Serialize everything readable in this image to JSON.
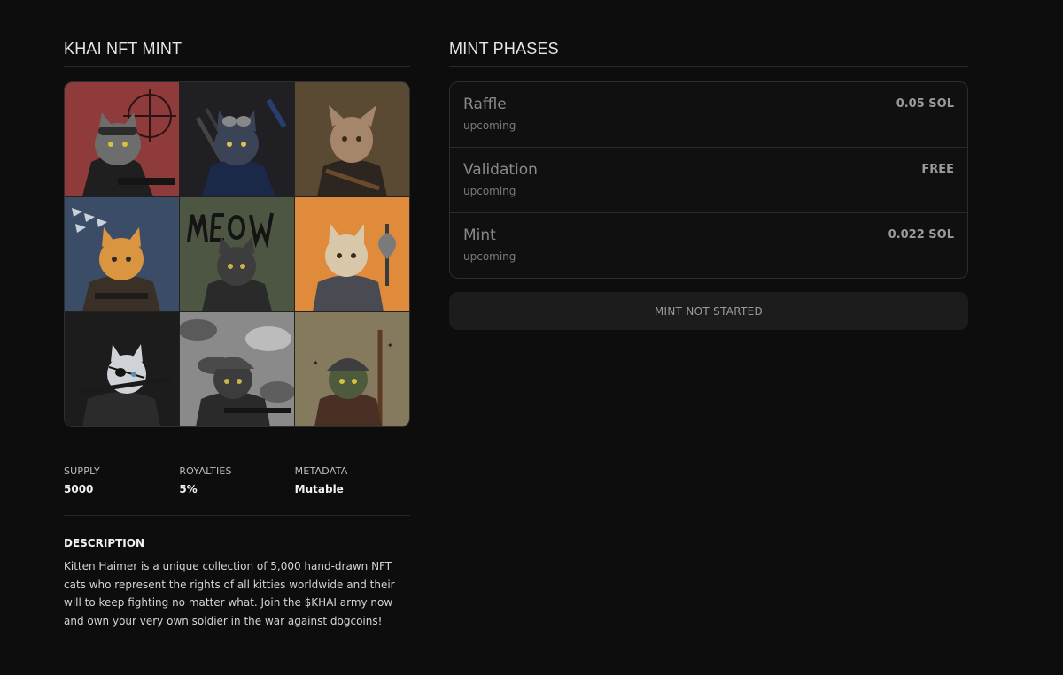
{
  "left": {
    "title": "KHAI NFT MINT",
    "gallery": [
      {
        "name": "cat-sniper",
        "bg": "#8f3b3b"
      },
      {
        "name": "cat-goggles-soldier",
        "bg": "#1f1f24"
      },
      {
        "name": "cat-warrior-bandolier",
        "bg": "#5a4a33"
      },
      {
        "name": "cat-pilot",
        "bg": "#3b4d66"
      },
      {
        "name": "cat-meow-soldier",
        "bg": "#4c5642"
      },
      {
        "name": "cat-axe-knight",
        "bg": "#e08a3c"
      },
      {
        "name": "cat-eyepatch",
        "bg": "#1c1c1c"
      },
      {
        "name": "cat-camo-soldier",
        "bg": "#8a8a8a"
      },
      {
        "name": "cat-rifleman",
        "bg": "#857a5e"
      }
    ],
    "stats": [
      {
        "label": "SUPPLY",
        "value": "5000"
      },
      {
        "label": "ROYALTIES",
        "value": "5%"
      },
      {
        "label": "METADATA",
        "value": "Mutable"
      }
    ],
    "description": {
      "title": "DESCRIPTION",
      "body": "Kitten Haimer is a unique collection of 5,000 hand-drawn NFT cats who represent the rights of all kitties worldwide and their will to keep fighting no matter what. Join the $KHAI army now and own your very own soldier in the war against dogcoins!"
    }
  },
  "right": {
    "title": "MINT PHASES",
    "phases": [
      {
        "name": "Raffle",
        "status": "upcoming",
        "price": "0.05 SOL"
      },
      {
        "name": "Validation",
        "status": "upcoming",
        "price": "FREE"
      },
      {
        "name": "Mint",
        "status": "upcoming",
        "price": "0.022 SOL"
      }
    ],
    "button_label": "MINT NOT STARTED"
  }
}
